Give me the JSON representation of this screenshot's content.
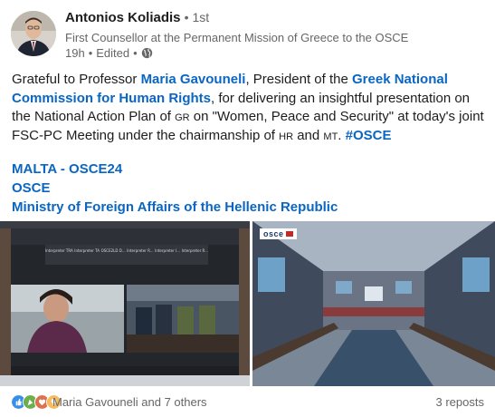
{
  "post": {
    "author": {
      "name": "Antonios Koliadis",
      "degree": "1st",
      "headline": "First Counsellor at the Permanent Mission of Greece to the OSCE",
      "time": "19h",
      "edited": "Edited",
      "visibility_icon": "globe-icon"
    },
    "text": {
      "t1": "Grateful to Professor ",
      "mention1": "Maria Gavouneli",
      "t2": ", President of the ",
      "mention2": "Greek National Commission for Human Rights",
      "t3": ", for delivering an insightful presentation on the National Action Plan of ",
      "abbr_gr": "GR",
      "t4": " on \"Women, Peace and Security\" at today's joint FSC-PC Meeting under the chairmanship of ",
      "abbr_hr": "HR",
      "t5": " and ",
      "abbr_mt": "MT",
      "t6": ". ",
      "hashtag": "#OSCE"
    },
    "mentions": [
      "MALTA - OSCE24",
      "OSCE",
      "Ministry of Foreign Affairs of the Hellenic Republic"
    ],
    "images": {
      "zoom_tiles": [
        "Interpreter TRA",
        "Interpreter TA",
        "OSCE2LD D...",
        "Interpreter R...",
        "Interpreter I...",
        "Interpreter R..."
      ],
      "osce_logo": "osce"
    },
    "social": {
      "reactions_text": "Maria Gavouneli and 7 others",
      "reposts": "3 reposts",
      "reaction_icons": [
        "like-icon",
        "celebrate-icon",
        "love-icon",
        "insightful-icon"
      ]
    },
    "colors": {
      "link": "#0a66c2",
      "text": "#1d1d1d",
      "muted": "#666666"
    }
  }
}
